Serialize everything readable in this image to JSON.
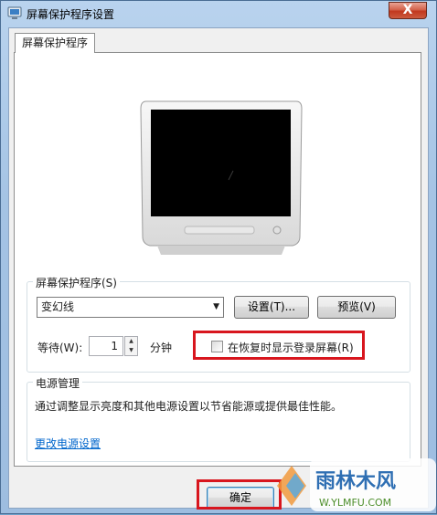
{
  "window": {
    "title": "屏幕保护程序设置",
    "close_label": "X"
  },
  "tab": {
    "label": "屏幕保护程序"
  },
  "screensaver": {
    "group_label": "屏幕保护程序(S)",
    "selected": "变幻线",
    "settings_button": "设置(T)...",
    "preview_button": "预览(V)",
    "wait_label": "等待(W):",
    "wait_value": "1",
    "minutes_label": "分钟",
    "resume_checkbox_label": "在恢复时显示登录屏幕(R)",
    "resume_checked": false
  },
  "power": {
    "group_label": "电源管理",
    "description": "通过调整显示亮度和其他电源设置以节省能源或提供最佳性能。",
    "link": "更改电源设置"
  },
  "footer": {
    "ok_button": "确定"
  },
  "watermark": {
    "text": "雨林木风",
    "url_text": "W.YLMFU.COM"
  },
  "colors": {
    "highlight_red": "#d8161e",
    "link_blue": "#0066cc"
  }
}
